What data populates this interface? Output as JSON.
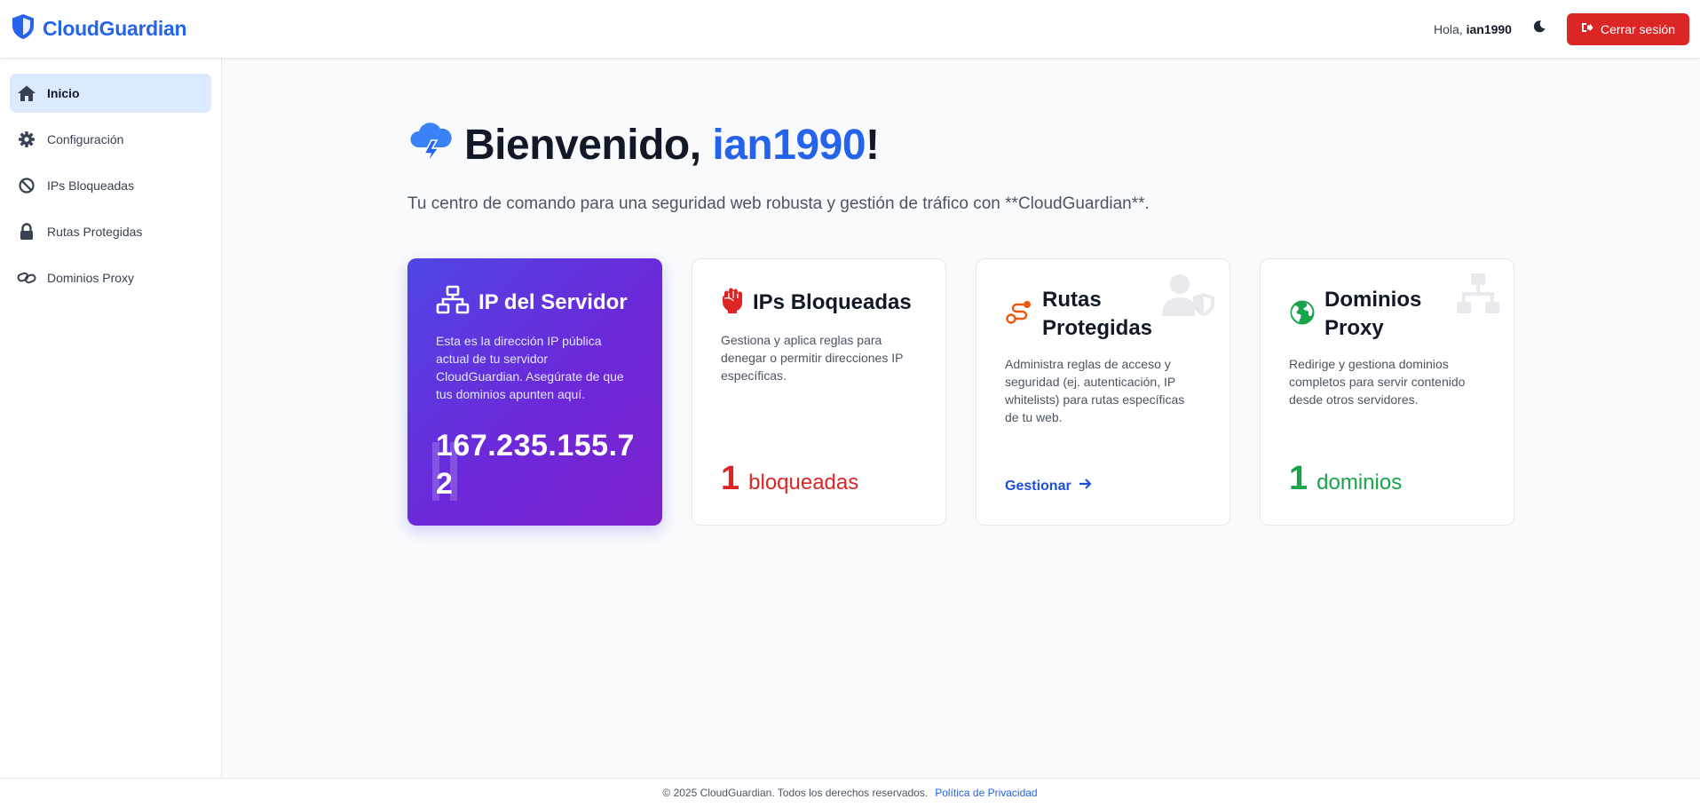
{
  "header": {
    "brand": "CloudGuardian",
    "greeting_prefix": "Hola,",
    "username": "ian1990",
    "logout_label": "Cerrar sesión"
  },
  "sidebar": {
    "items": [
      {
        "label": "Inicio",
        "icon": "home-icon",
        "active": true
      },
      {
        "label": "Configuración",
        "icon": "gear-icon",
        "active": false
      },
      {
        "label": "IPs Bloqueadas",
        "icon": "ban-icon",
        "active": false
      },
      {
        "label": "Rutas Protegidas",
        "icon": "lock-icon",
        "active": false
      },
      {
        "label": "Dominios Proxy",
        "icon": "link-icon",
        "active": false
      }
    ]
  },
  "main": {
    "welcome_prefix": "Bienvenido, ",
    "username": "ian1990",
    "welcome_suffix": "!",
    "subtitle": "Tu centro de comando para una seguridad web robusta y gestión de tráfico con **CloudGuardian**.",
    "cards": [
      {
        "title": "IP del Servidor",
        "icon": "network-icon",
        "description": "Esta es la dirección IP pública actual de tu servidor CloudGuardian. Asegúrate de que tus dominios apunten aquí.",
        "value": "167.235.155.72"
      },
      {
        "title": "IPs Bloqueadas",
        "icon": "raised-fist-icon",
        "description": "Gestiona y aplica reglas para denegar o permitir direcciones IP específicas.",
        "count": "1",
        "count_label": "bloqueadas"
      },
      {
        "title": "Rutas Protegidas",
        "icon": "route-icon",
        "description": "Administra reglas de acceso y seguridad (ej. autenticación, IP whitelists) para rutas específicas de tu web.",
        "link_label": "Gestionar"
      },
      {
        "title": "Dominios Proxy",
        "icon": "globe-icon",
        "description": "Redirige y gestiona dominios completos para servir contenido desde otros servidores.",
        "count": "1",
        "count_label": "dominios"
      }
    ]
  },
  "footer": {
    "copyright": "© 2025 CloudGuardian. Todos los derechos reservados.",
    "privacy_link": "Política de Privacidad"
  },
  "colors": {
    "primary": "#2563eb",
    "danger": "#dc2626",
    "success": "#16a34a",
    "sidebar_active": "#dbeafe"
  }
}
